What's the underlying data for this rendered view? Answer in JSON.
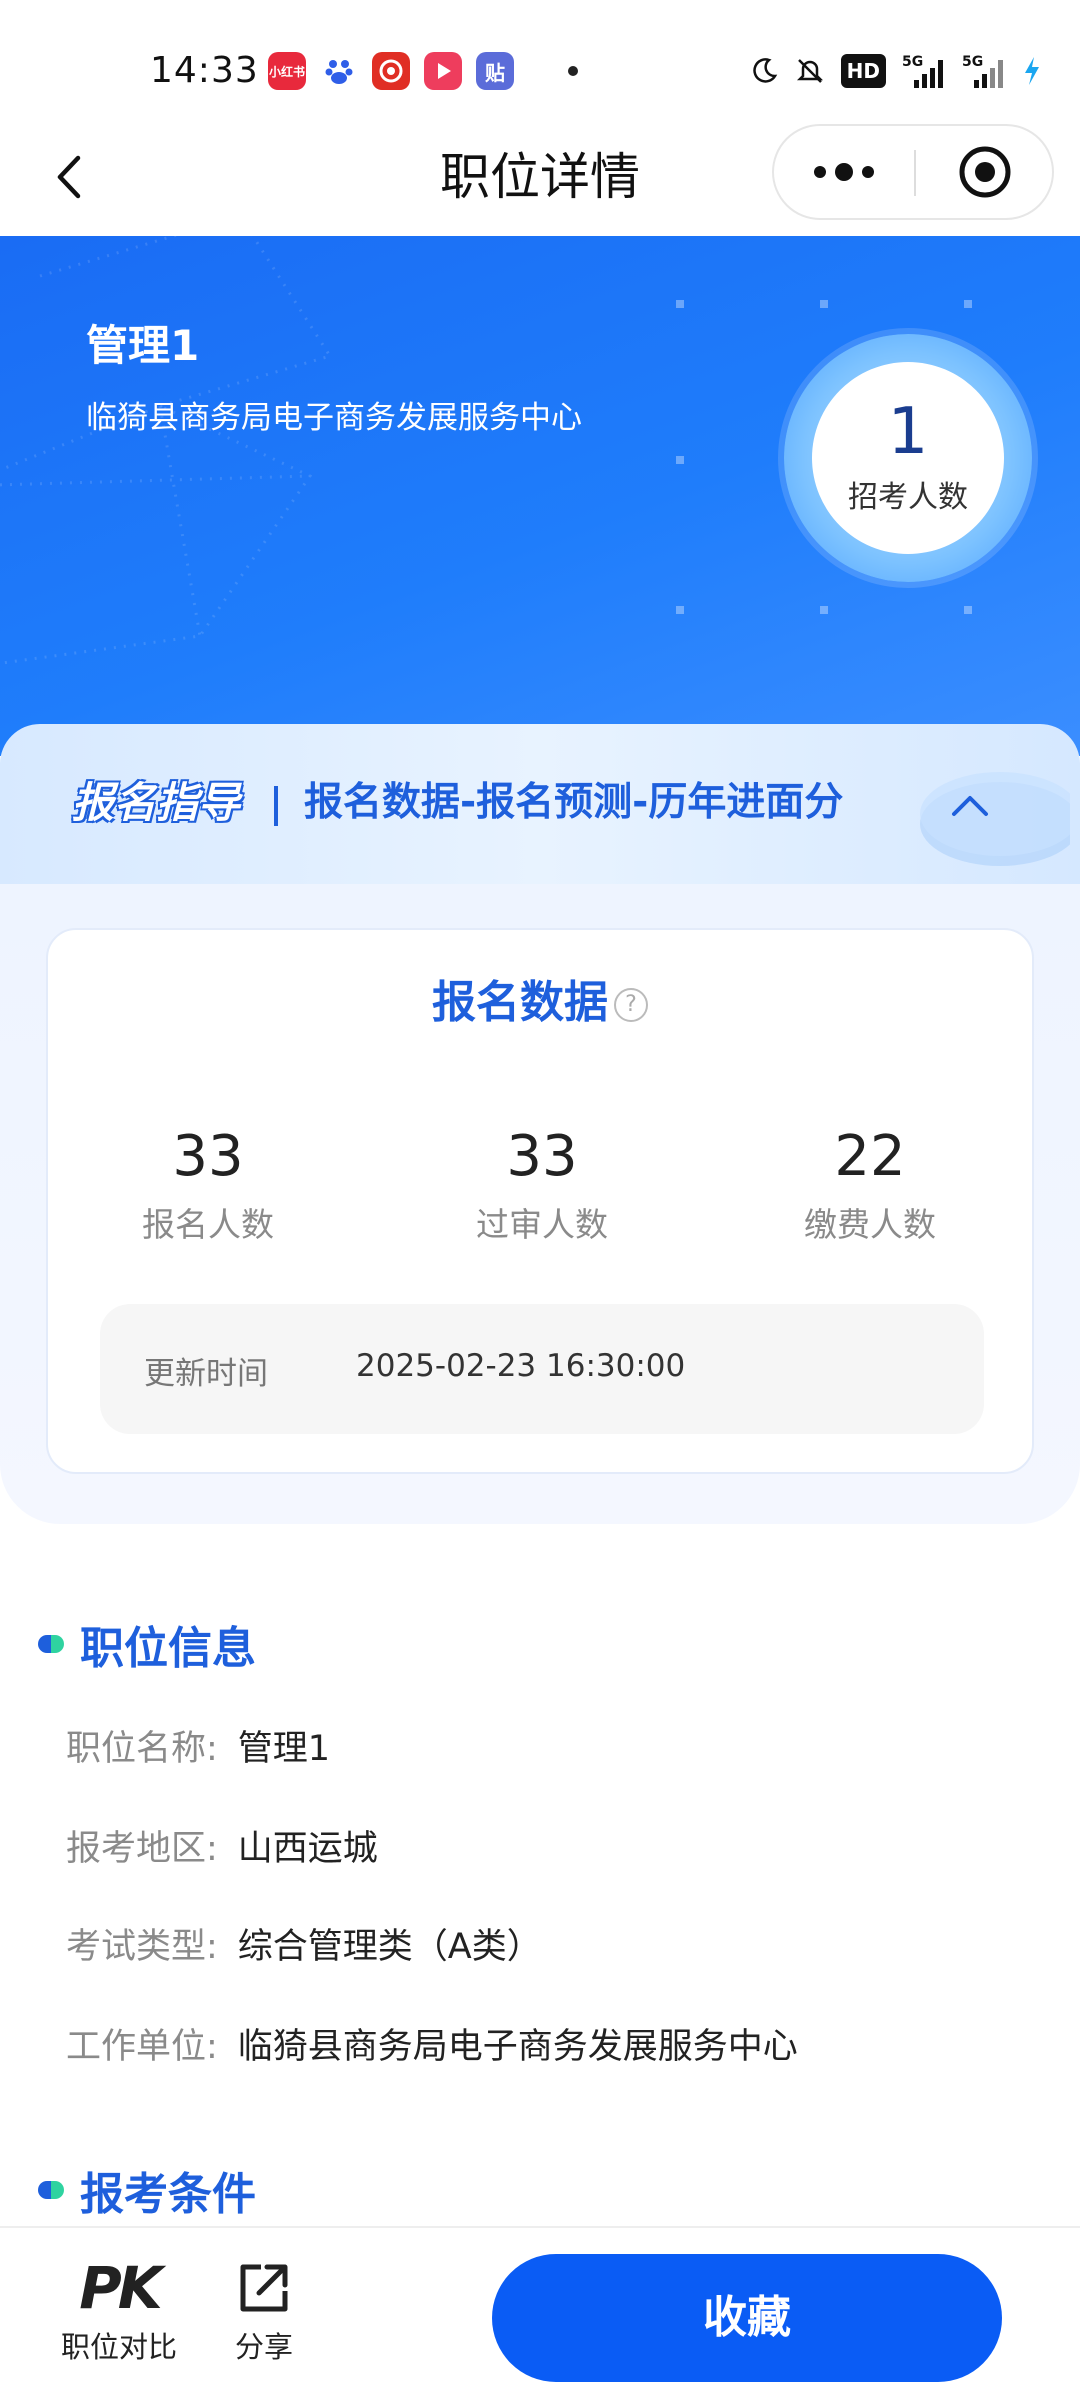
{
  "status_bar": {
    "time": "14:33",
    "apps": [
      {
        "icon": "xiaohongshu-icon",
        "text": "小红书",
        "color": "#e8293c"
      },
      {
        "icon": "baidu-icon",
        "text": "",
        "color": "#ffffff"
      },
      {
        "icon": "pinduoduo-icon",
        "text": "",
        "color": "#e02e24"
      },
      {
        "icon": "video-play-icon",
        "text": "",
        "color": "#ee3d5d"
      },
      {
        "icon": "tieba-icon",
        "text": "贴",
        "color": "#5b6cd9"
      }
    ],
    "indicators": [
      "moon-icon",
      "mute-icon",
      "HD",
      "5G",
      "5G",
      "charging-icon"
    ]
  },
  "header": {
    "title": "职位详情"
  },
  "hero": {
    "position_name": "管理1",
    "employer": "临猗县商务局电子商务发展服务中心",
    "recruit_count": "1",
    "recruit_label": "招考人数"
  },
  "guide": {
    "tag": "报名指导",
    "links": "报名数据-报名预测-历年进面分"
  },
  "registration": {
    "title": "报名数据",
    "stats": [
      {
        "value": "33",
        "label": "报名人数"
      },
      {
        "value": "33",
        "label": "过审人数"
      },
      {
        "value": "22",
        "label": "缴费人数"
      }
    ],
    "update_label": "更新时间",
    "update_time": "2025-02-23 16:30:00"
  },
  "position_info": {
    "title": "职位信息",
    "rows": [
      {
        "key": "职位名称:",
        "value": "管理1"
      },
      {
        "key": "报考地区:",
        "value": "山西运城"
      },
      {
        "key": "考试类型:",
        "value": "综合管理类（A类）"
      },
      {
        "key": "工作单位:",
        "value": "临猗县商务局电子商务发展服务中心"
      }
    ]
  },
  "conditions": {
    "title": "报考条件"
  },
  "bottom_bar": {
    "compare_icon": "PK",
    "compare_label": "职位对比",
    "share_label": "分享",
    "favorite_label": "收藏"
  },
  "colors": {
    "brand_blue": "#1e5fdc",
    "button_blue": "#0a5cf5",
    "hero_blue": "#1f7dfb"
  }
}
